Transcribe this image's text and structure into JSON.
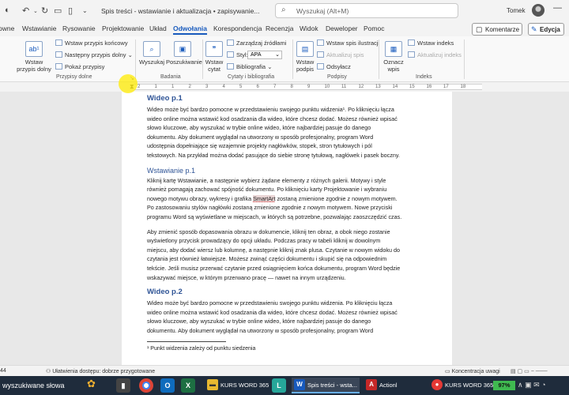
{
  "window": {
    "doc_title": "Spis treści - wstawianie i aktualizacja • zapisywanie...",
    "search_placeholder": "Wyszukaj (Alt+M)",
    "user": "Tomek"
  },
  "tabs": [
    "owne",
    "Wstawianie",
    "Rysowanie",
    "Projektowanie",
    "Układ",
    "Odwołania",
    "Korespondencja",
    "Recenzja",
    "Widok",
    "Deweloper",
    "Pomoc"
  ],
  "active_tab": "Odwołania",
  "header_buttons": {
    "comments": "Komentarze",
    "edit": "Edycja"
  },
  "ribbon": {
    "footnotes": {
      "insert_footnote": "Wstaw przypis dolny",
      "insert_endnote": "Wstaw przypis końcowy",
      "next_footnote": "Następny przypis dolny",
      "show_notes": "Pokaż przypisy",
      "group": "Przypisy dolne"
    },
    "research": {
      "search": "Wyszukaj",
      "researcher": "Poszukiwanie",
      "group": "Badania"
    },
    "citations": {
      "insert_citation": "Wstaw cytat",
      "manage_sources": "Zarządzaj źródłami",
      "style_label": "Styl:",
      "style_value": "APA",
      "bibliography": "Bibliografia",
      "group": "Cytaty i bibliografia"
    },
    "captions": {
      "insert_caption": "Wstaw podpis",
      "insert_table_figures": "Wstaw spis ilustracji",
      "update_table": "Aktualizuj spis",
      "cross_reference": "Odsyłacz",
      "group": "Podpisy"
    },
    "index": {
      "mark_entry": "Oznacz wpis",
      "insert_index": "Wstaw indeks",
      "update_index": "Aktualizuj indeks",
      "group": "Indeks"
    }
  },
  "ruler": [
    "2",
    "1",
    "1",
    "2",
    "3",
    "4",
    "5",
    "6",
    "7",
    "8",
    "9",
    "10",
    "11",
    "12",
    "13",
    "14",
    "15",
    "16",
    "17",
    "18"
  ],
  "document": {
    "h1_1": "Wideo p.1",
    "p1": [
      "Wideo może być bardzo pomocne w przedstawieniu swojego punktu widzenia¹. Po kliknięciu łącza",
      "wideo online można wstawić kod osadzania dla wideo, które chcesz dodać. Możesz również wpisać",
      "słowo kluczowe, aby wyszukać w trybie online wideo, które najbardziej pasuje do danego",
      "dokumentu. Aby dokument wyglądał na utworzony w sposób profesjonalny, program Word",
      "udostępnia dopełniające się wzajemnie projekty nagłówków, stopek, stron tytułowych i pól",
      "tekstowych. Na przykład można dodać pasujące do siebie stronę tytułową, nagłówek i pasek boczny."
    ],
    "h2_1": "Wstawianie p.1",
    "p2": [
      "Kliknij kartę Wstawianie, a następnie wybierz żądane elementy z różnych galerii. Motywy i style",
      "również pomagają zachować spójność dokumentu. Po kliknięciu karty Projektowanie i wybraniu"
    ],
    "p2_line3_before": "nowego motywu obrazy, wykresy i grafika ",
    "p2_line3_mark": "SmartArt",
    "p2_line3_after": " zostaną zmienione zgodnie z nowym motywem.",
    "p2_rest": [
      "Po zastosowaniu stylów nagłówki zostaną zmienione zgodnie z nowym motywem. Nowe przyciski",
      "programu Word są wyświetlane w miejscach, w których są potrzebne, pozwalając zaoszczędzić czas."
    ],
    "p3": [
      "Aby zmienić sposób dopasowania obrazu w dokumencie, kliknij ten obraz, a obok niego zostanie",
      "wyświetlony przycisk prowadzący do opcji układu. Podczas pracy w tabeli kliknij w dowolnym",
      "miejscu, aby dodać wiersz lub kolumnę, a następnie kliknij znak plusa. Czytanie w nowym widoku do",
      "czytania jest również łatwiejsze. Możesz zwinąć części dokumentu i skupić się na odpowiednim",
      "tekście. Jeśli musisz przerwać czytanie przed osiągnięciem końca dokumentu, program Word będzie",
      "wskazywać miejsce, w którym przerwano pracę — nawet na innym urządzeniu."
    ],
    "h1_2": "Wideo p.2",
    "p4": [
      "Wideo może być bardzo pomocne w przedstawieniu swojego punktu widzenia. Po kliknięciu łącza",
      "wideo online można wstawić kod osadzania dla wideo, które chcesz dodać. Możesz również wpisać",
      "słowo kluczowe, aby wyszukać w trybie online wideo, które najbardziej pasuje do danego",
      "dokumentu. Aby dokument wyglądał na utworzony w sposób profesjonalny, program Word"
    ],
    "footnote": "¹ Punkt widzenia zależy od punktu siedzenia"
  },
  "status": {
    "page_words": "44",
    "accessibility": "Ułatwienia dostępu: dobrze przygotowane",
    "focus": "Koncentracja uwagi"
  },
  "taskbar": {
    "search": "wyszukiwane słowa",
    "items": [
      "KURS WORD 365",
      "Spis treści - wsta...",
      "Actionl",
      "KURS WORD 365 ..."
    ],
    "battery": "97%"
  },
  "colors": {
    "accent": "#185abd",
    "heading": "#2f5496",
    "taskbar": "#1f2c3c",
    "battery": "#3fb950"
  }
}
